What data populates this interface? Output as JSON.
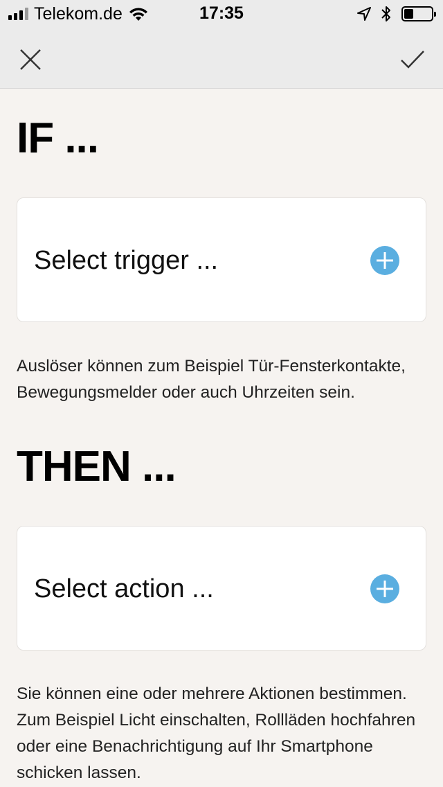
{
  "status_bar": {
    "carrier": "Telekom.de",
    "time": "17:35",
    "battery_level": 0.35
  },
  "nav": {
    "close_icon": "close-icon",
    "confirm_icon": "checkmark-icon"
  },
  "if_section": {
    "title": "IF ...",
    "card_label": "Select trigger ...",
    "hint": "Auslöser können zum Beispiel Tür-Fensterkontakte, Bewegungsmelder oder auch Uhrzeiten sein."
  },
  "then_section": {
    "title": "THEN ...",
    "card_label": "Select action ...",
    "hint": "Sie können eine oder mehrere Aktionen bestimmen. Zum Beispiel Licht einschalten, Rollläden hochfahren oder eine Benachrichtigung auf Ihr Smartphone schicken lassen."
  },
  "colors": {
    "accent": "#5aaee0",
    "background": "#f6f3f0",
    "bar": "#ebebeb"
  }
}
